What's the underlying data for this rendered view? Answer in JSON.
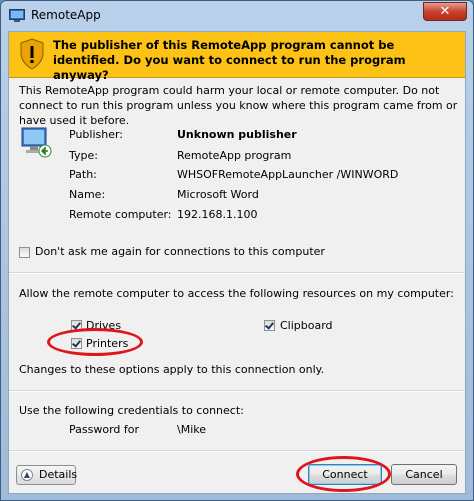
{
  "window": {
    "title": "RemoteApp",
    "close_glyph": "✕"
  },
  "banner": {
    "text": "The publisher of this RemoteApp program cannot be identified. Do you want to connect to run the program anyway?"
  },
  "warning": "This RemoteApp program could harm your local or remote computer. Do not connect to run this program unless you know where this program came from or have used it before.",
  "details": {
    "publisher_label": "Publisher:",
    "publisher_value": "Unknown publisher",
    "type_label": "Type:",
    "type_value": "RemoteApp program",
    "path_label": "Path:",
    "path_value": "WHSOFRemoteAppLauncher /WINWORD",
    "name_label": "Name:",
    "name_value": "Microsoft Word",
    "remote_label": "Remote computer:",
    "remote_value": "192.168.1.100"
  },
  "dont_ask": {
    "label": "Don't ask me again for connections to this computer",
    "checked": false
  },
  "resources": {
    "heading": "Allow the remote computer to access the following resources on my computer:",
    "drives": {
      "label": "Drives",
      "checked": true
    },
    "clipboard": {
      "label": "Clipboard",
      "checked": true
    },
    "printers": {
      "label": "Printers",
      "checked": true
    },
    "note": "Changes to these options apply to this connection only."
  },
  "credentials": {
    "heading": "Use the following credentials to connect:",
    "password_label": "Password for",
    "password_value": "\\Mike"
  },
  "footer": {
    "details_label": "Details",
    "connect_label": "Connect",
    "cancel_label": "Cancel"
  },
  "colors": {
    "banner": "#fcc216",
    "highlight": "#e0141b"
  },
  "icons": [
    "remoteapp-icon",
    "close-icon",
    "shield-warning-icon",
    "computer-icon",
    "chevron-up-icon"
  ]
}
